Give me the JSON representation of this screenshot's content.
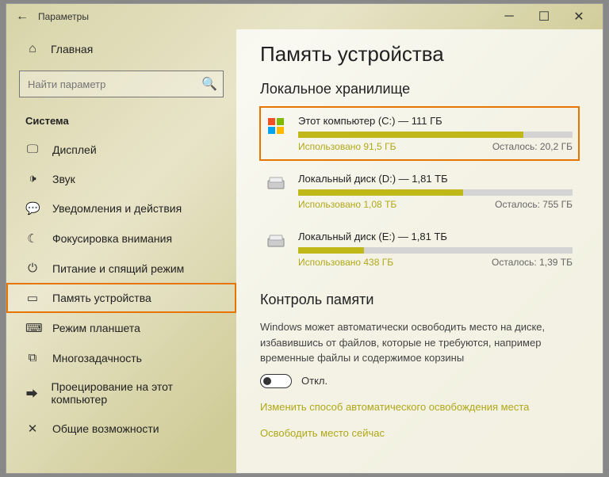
{
  "window": {
    "title": "Параметры"
  },
  "home": {
    "label": "Главная"
  },
  "search": {
    "placeholder": "Найти параметр"
  },
  "section": {
    "title": "Система"
  },
  "nav": {
    "items": [
      {
        "label": "Дисплей",
        "icon": "display"
      },
      {
        "label": "Звук",
        "icon": "sound"
      },
      {
        "label": "Уведомления и действия",
        "icon": "notify"
      },
      {
        "label": "Фокусировка внимания",
        "icon": "focus"
      },
      {
        "label": "Питание и спящий режим",
        "icon": "power"
      },
      {
        "label": "Память устройства",
        "icon": "storage",
        "selected": true
      },
      {
        "label": "Режим планшета",
        "icon": "tablet"
      },
      {
        "label": "Многозадачность",
        "icon": "multitask"
      },
      {
        "label": "Проецирование на этот компьютер",
        "icon": "project"
      },
      {
        "label": "Общие возможности",
        "icon": "shared"
      }
    ]
  },
  "page": {
    "title": "Память устройства",
    "localStorage": "Локальное хранилище",
    "drives": [
      {
        "name": "Этот компьютер (C:) — 111 ГБ",
        "used": "Использовано 91,5 ГБ",
        "remain": "Осталось: 20,2 ГБ",
        "pct": 82,
        "highlight": true,
        "os": true
      },
      {
        "name": "Локальный диск (D:) — 1,81 ТБ",
        "used": "Использовано 1,08 ТБ",
        "remain": "Осталось: 755 ГБ",
        "pct": 60,
        "highlight": false,
        "os": false
      },
      {
        "name": "Локальный диск (E:) — 1,81 ТБ",
        "used": "Использовано 438 ГБ",
        "remain": "Осталось: 1,39 ТБ",
        "pct": 24,
        "highlight": false,
        "os": false
      }
    ],
    "sense": {
      "title": "Контроль памяти",
      "desc": "Windows может автоматически освободить место на диске, избавившись от файлов, которые не требуются, например временные файлы и содержимое корзины",
      "toggle": "Откл.",
      "link1": "Изменить способ автоматического освобождения места",
      "link2": "Освободить место сейчас"
    }
  }
}
